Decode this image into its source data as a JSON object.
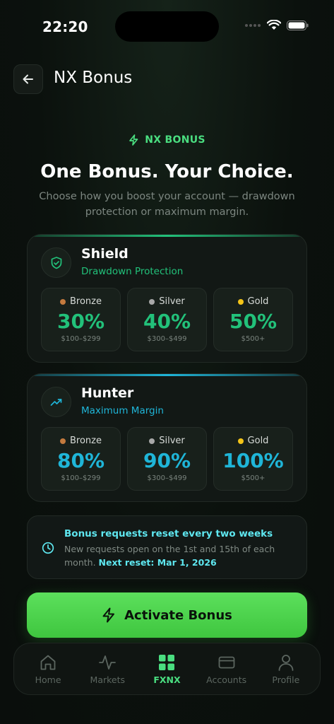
{
  "status": {
    "time": "22:20"
  },
  "header": {
    "title": "NX Bonus"
  },
  "hero": {
    "eyebrow": "NX BONUS",
    "title": "One Bonus. Your Choice.",
    "subtitle": "Choose how you boost your account — drawdown protection or maximum margin."
  },
  "plans": [
    {
      "name": "Shield",
      "subtitle": "Drawdown Protection",
      "accent": "#22c17a",
      "icon": "shield-check-icon",
      "tiers": [
        {
          "label": "Bronze",
          "pct": "30%",
          "range": "$100–$299",
          "dot": "#c47a3e"
        },
        {
          "label": "Silver",
          "pct": "40%",
          "range": "$300–$499",
          "dot": "#a8a8a8"
        },
        {
          "label": "Gold",
          "pct": "50%",
          "range": "$500+",
          "dot": "#f5c518"
        }
      ]
    },
    {
      "name": "Hunter",
      "subtitle": "Maximum Margin",
      "accent": "#1fb5d8",
      "icon": "trending-up-icon",
      "tiers": [
        {
          "label": "Bronze",
          "pct": "80%",
          "range": "$100–$299",
          "dot": "#c47a3e"
        },
        {
          "label": "Silver",
          "pct": "90%",
          "range": "$300–$499",
          "dot": "#a8a8a8"
        },
        {
          "label": "Gold",
          "pct": "100%",
          "range": "$500+",
          "dot": "#f5c518"
        }
      ]
    }
  ],
  "info": {
    "title": "Bonus requests reset every two weeks",
    "text": "New requests open on the 1st and 15th of each month.",
    "next_reset": "Next reset: Mar 1, 2026"
  },
  "cta": {
    "label": "Activate Bonus"
  },
  "tabs": [
    {
      "label": "Home",
      "icon": "home-icon",
      "active": false
    },
    {
      "label": "Markets",
      "icon": "activity-icon",
      "active": false
    },
    {
      "label": "FXNX",
      "icon": "grid-icon",
      "active": true
    },
    {
      "label": "Accounts",
      "icon": "card-icon",
      "active": false
    },
    {
      "label": "Profile",
      "icon": "user-icon",
      "active": false
    }
  ],
  "colors": {
    "accent": "#4ade80",
    "info_accent": "#5ee7f0"
  }
}
